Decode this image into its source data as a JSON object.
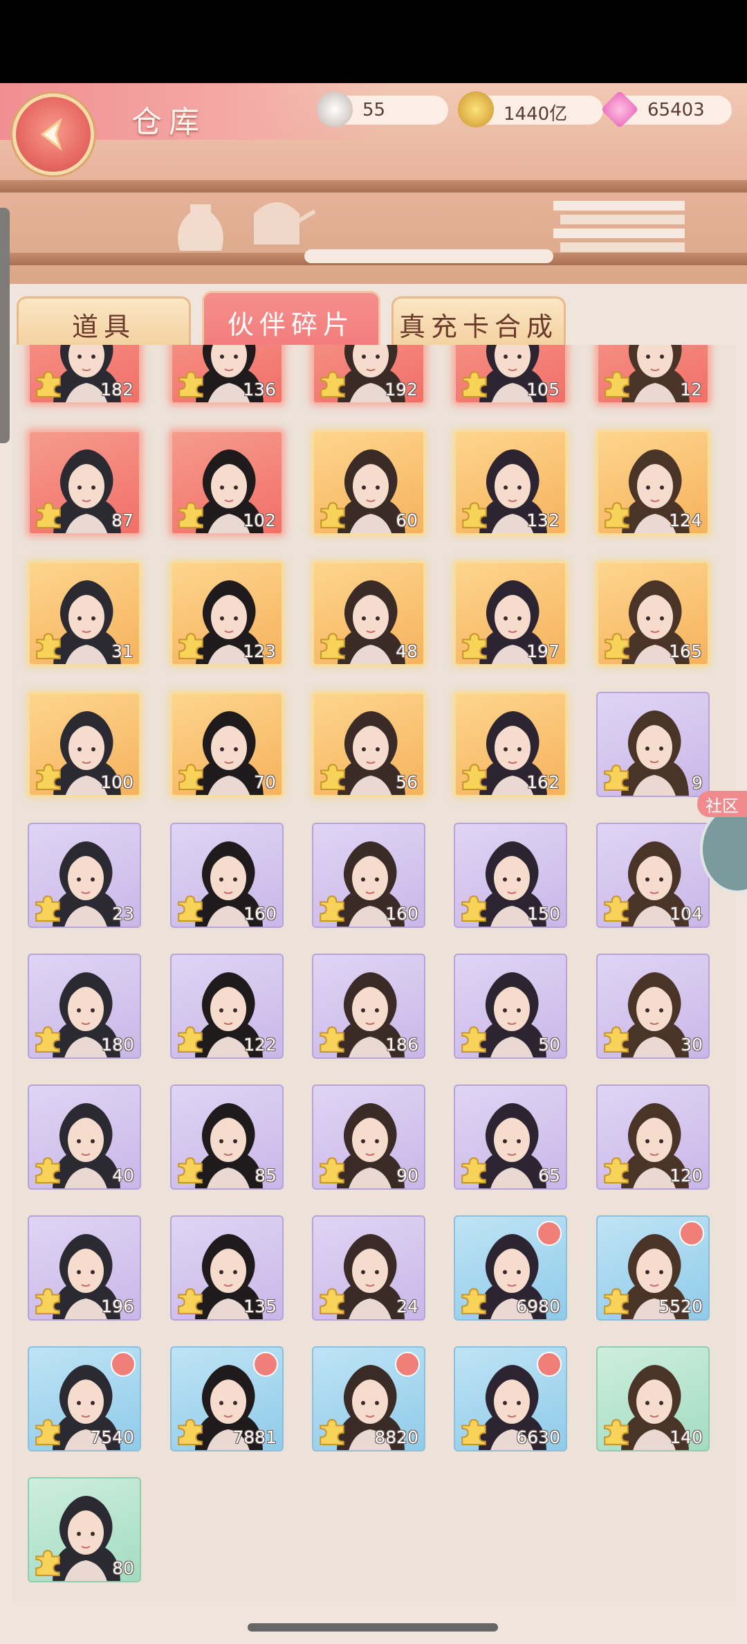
{
  "header": {
    "title": "仓库",
    "resources": [
      {
        "name": "feather-token",
        "icon": "pearl-icon",
        "value": "55"
      },
      {
        "name": "coin",
        "icon": "copper-coin-icon",
        "value": "1440亿"
      },
      {
        "name": "diamond",
        "icon": "pink-gem-icon",
        "value": "65403"
      }
    ]
  },
  "tabs": [
    {
      "label": "道具",
      "active": false
    },
    {
      "label": "伙伴碎片",
      "active": true
    },
    {
      "label": "真充卡合成",
      "active": false
    }
  ],
  "side_tab": {
    "label": "社区"
  },
  "fragments": [
    {
      "count": "182",
      "rarity": "red"
    },
    {
      "count": "136",
      "rarity": "red"
    },
    {
      "count": "192",
      "rarity": "red"
    },
    {
      "count": "105",
      "rarity": "red"
    },
    {
      "count": "12",
      "rarity": "red"
    },
    {
      "count": "87",
      "rarity": "red"
    },
    {
      "count": "102",
      "rarity": "red"
    },
    {
      "count": "60",
      "rarity": "orange"
    },
    {
      "count": "132",
      "rarity": "orange"
    },
    {
      "count": "124",
      "rarity": "orange"
    },
    {
      "count": "31",
      "rarity": "orange"
    },
    {
      "count": "123",
      "rarity": "orange"
    },
    {
      "count": "48",
      "rarity": "orange"
    },
    {
      "count": "197",
      "rarity": "orange"
    },
    {
      "count": "165",
      "rarity": "orange"
    },
    {
      "count": "100",
      "rarity": "orange"
    },
    {
      "count": "70",
      "rarity": "orange"
    },
    {
      "count": "56",
      "rarity": "orange"
    },
    {
      "count": "162",
      "rarity": "orange"
    },
    {
      "count": "9",
      "rarity": "purple"
    },
    {
      "count": "23",
      "rarity": "purple"
    },
    {
      "count": "160",
      "rarity": "purple"
    },
    {
      "count": "160",
      "rarity": "purple"
    },
    {
      "count": "150",
      "rarity": "purple"
    },
    {
      "count": "104",
      "rarity": "purple"
    },
    {
      "count": "180",
      "rarity": "purple"
    },
    {
      "count": "122",
      "rarity": "purple"
    },
    {
      "count": "186",
      "rarity": "purple"
    },
    {
      "count": "50",
      "rarity": "purple"
    },
    {
      "count": "30",
      "rarity": "purple"
    },
    {
      "count": "40",
      "rarity": "purple"
    },
    {
      "count": "85",
      "rarity": "purple"
    },
    {
      "count": "90",
      "rarity": "purple"
    },
    {
      "count": "65",
      "rarity": "purple"
    },
    {
      "count": "120",
      "rarity": "purple"
    },
    {
      "count": "196",
      "rarity": "purple"
    },
    {
      "count": "135",
      "rarity": "purple"
    },
    {
      "count": "24",
      "rarity": "purple"
    },
    {
      "count": "6980",
      "rarity": "blue",
      "badge": true
    },
    {
      "count": "5520",
      "rarity": "blue",
      "badge": true
    },
    {
      "count": "7540",
      "rarity": "blue",
      "badge": true
    },
    {
      "count": "7881",
      "rarity": "blue",
      "badge": true
    },
    {
      "count": "8820",
      "rarity": "blue",
      "badge": true
    },
    {
      "count": "6630",
      "rarity": "blue",
      "badge": true
    },
    {
      "count": "140",
      "rarity": "green"
    },
    {
      "count": "80",
      "rarity": "green"
    }
  ],
  "colors": {
    "accent": "#f27b7b",
    "panel": "#ece2d8"
  }
}
